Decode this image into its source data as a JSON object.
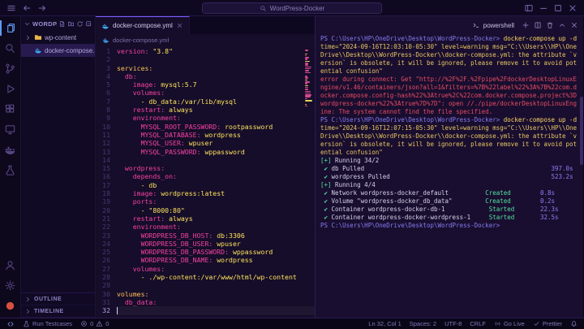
{
  "title_bar": {
    "search_value": "WordPress-Docker",
    "left_icons": [
      {
        "name": "menu",
        "icon": "menu"
      },
      {
        "name": "back",
        "icon": "arrow-left"
      },
      {
        "name": "forward",
        "icon": "arrow-right"
      }
    ],
    "right_icons": [
      {
        "name": "layout-toggle",
        "icon": "layout"
      },
      {
        "name": "minimize",
        "icon": "minimize"
      },
      {
        "name": "maximize",
        "icon": "maximize"
      },
      {
        "name": "close-window",
        "icon": "close"
      }
    ]
  },
  "activity_bar": {
    "top": [
      {
        "name": "explorer",
        "icon": "files",
        "active": true
      },
      {
        "name": "search",
        "icon": "search"
      },
      {
        "name": "source-control",
        "icon": "source-control"
      },
      {
        "name": "run-debug",
        "icon": "play"
      },
      {
        "name": "extensions",
        "icon": "extensions"
      },
      {
        "name": "remote-explorer",
        "icon": "monitor"
      },
      {
        "name": "docker",
        "icon": "docker"
      },
      {
        "name": "testing",
        "icon": "beaker"
      }
    ],
    "bottom": [
      {
        "name": "account",
        "icon": "account"
      },
      {
        "name": "settings",
        "icon": "gear"
      },
      {
        "name": "profile-badge",
        "icon": "dot",
        "color": "#d75040"
      }
    ]
  },
  "sidebar": {
    "header": "WORDP...",
    "actions": [
      "new-file",
      "new-folder",
      "refresh",
      "collapse-all"
    ],
    "items": [
      {
        "label": "wp-content",
        "type": "folder",
        "chevron": true
      },
      {
        "label": "docker-compose...",
        "type": "docker-file",
        "selected": true
      }
    ],
    "sections": [
      {
        "label": "OUTLINE"
      },
      {
        "label": "TIMELINE"
      }
    ]
  },
  "editor": {
    "tab": {
      "label": "docker-compose.yml",
      "icon": "docker-file"
    },
    "breadcrumb": {
      "label": "docker-compose.yml",
      "icon": "docker-file"
    },
    "cursor_line": 32,
    "lines": [
      {
        "n": 1,
        "tokens": [
          [
            "k",
            "version:"
          ],
          [
            "v",
            " \"3.8\""
          ]
        ]
      },
      {
        "n": 2,
        "tokens": []
      },
      {
        "n": 3,
        "tokens": [
          [
            "t",
            "services:"
          ]
        ]
      },
      {
        "n": 4,
        "tokens": [
          [
            "w",
            "  "
          ],
          [
            "k",
            "db:"
          ]
        ]
      },
      {
        "n": 5,
        "tokens": [
          [
            "w",
            "    "
          ],
          [
            "k",
            "image:"
          ],
          [
            "v",
            " mysql:5.7"
          ]
        ]
      },
      {
        "n": 6,
        "tokens": [
          [
            "w",
            "    "
          ],
          [
            "k",
            "volumes:"
          ]
        ]
      },
      {
        "n": 7,
        "tokens": [
          [
            "w",
            "      "
          ],
          [
            "v",
            "- db_data:/var/lib/mysql"
          ]
        ]
      },
      {
        "n": 8,
        "tokens": [
          [
            "w",
            "    "
          ],
          [
            "k",
            "restart:"
          ],
          [
            "v",
            " always"
          ]
        ]
      },
      {
        "n": 9,
        "tokens": [
          [
            "w",
            "    "
          ],
          [
            "k",
            "environment:"
          ]
        ]
      },
      {
        "n": 10,
        "tokens": [
          [
            "w",
            "      "
          ],
          [
            "k",
            "MYSQL_ROOT_PASSWORD:"
          ],
          [
            "v",
            " rootpassword"
          ]
        ]
      },
      {
        "n": 11,
        "tokens": [
          [
            "w",
            "      "
          ],
          [
            "k",
            "MYSQL_DATABASE:"
          ],
          [
            "v",
            " wordpress"
          ]
        ]
      },
      {
        "n": 12,
        "tokens": [
          [
            "w",
            "      "
          ],
          [
            "k",
            "MYSQL_USER:"
          ],
          [
            "v",
            " wpuser"
          ]
        ]
      },
      {
        "n": 13,
        "tokens": [
          [
            "w",
            "      "
          ],
          [
            "k",
            "MYSQL_PASSWORD:"
          ],
          [
            "v",
            " wppassword"
          ]
        ]
      },
      {
        "n": 14,
        "tokens": []
      },
      {
        "n": 15,
        "tokens": [
          [
            "w",
            "  "
          ],
          [
            "k",
            "wordpress:"
          ]
        ]
      },
      {
        "n": 16,
        "tokens": [
          [
            "w",
            "    "
          ],
          [
            "k",
            "depends_on:"
          ]
        ]
      },
      {
        "n": 17,
        "tokens": [
          [
            "w",
            "      "
          ],
          [
            "v",
            "- db"
          ]
        ]
      },
      {
        "n": 18,
        "tokens": [
          [
            "w",
            "    "
          ],
          [
            "k",
            "image:"
          ],
          [
            "v",
            " wordpress:latest"
          ]
        ]
      },
      {
        "n": 19,
        "tokens": [
          [
            "w",
            "    "
          ],
          [
            "k",
            "ports:"
          ]
        ]
      },
      {
        "n": 20,
        "tokens": [
          [
            "w",
            "      "
          ],
          [
            "v",
            "- \"8000:80\""
          ]
        ]
      },
      {
        "n": 21,
        "tokens": [
          [
            "w",
            "    "
          ],
          [
            "k",
            "restart:"
          ],
          [
            "v",
            " always"
          ]
        ]
      },
      {
        "n": 22,
        "tokens": [
          [
            "w",
            "    "
          ],
          [
            "k",
            "environment:"
          ]
        ]
      },
      {
        "n": 23,
        "tokens": [
          [
            "w",
            "      "
          ],
          [
            "k",
            "WORDPRESS_DB_HOST:"
          ],
          [
            "v",
            " db:3306"
          ]
        ]
      },
      {
        "n": 24,
        "tokens": [
          [
            "w",
            "      "
          ],
          [
            "k",
            "WORDPRESS_DB_USER:"
          ],
          [
            "v",
            " wpuser"
          ]
        ]
      },
      {
        "n": 25,
        "tokens": [
          [
            "w",
            "      "
          ],
          [
            "k",
            "WORDPRESS_DB_PASSWORD:"
          ],
          [
            "v",
            " wppassword"
          ]
        ]
      },
      {
        "n": 26,
        "tokens": [
          [
            "w",
            "      "
          ],
          [
            "k",
            "WORDPRESS_DB_NAME:"
          ],
          [
            "v",
            " wordpress"
          ]
        ]
      },
      {
        "n": 27,
        "tokens": [
          [
            "w",
            "    "
          ],
          [
            "k",
            "volumes:"
          ]
        ]
      },
      {
        "n": 28,
        "tokens": [
          [
            "w",
            "      "
          ],
          [
            "v",
            "- ./wp-content:/var/www/html/wp-content"
          ]
        ]
      },
      {
        "n": 29,
        "tokens": []
      },
      {
        "n": 30,
        "tokens": [
          [
            "t",
            "volumes:"
          ]
        ]
      },
      {
        "n": 31,
        "tokens": [
          [
            "w",
            "  "
          ],
          [
            "k",
            "db_data:"
          ]
        ]
      },
      {
        "n": 32,
        "tokens": []
      }
    ]
  },
  "terminal": {
    "tab_label": "powershell",
    "actions": [
      "add",
      "split",
      "trash",
      "chevron-up",
      "close"
    ],
    "lines": [
      {
        "seg": [
          [
            "pr",
            "PS C:\\Users\\HP\\OneDrive\\Desktop\\WordPress-Docker>"
          ],
          [
            "cm",
            " docker-compose up -d"
          ]
        ]
      },
      {
        "seg": [
          [
            "wr",
            "time=\"2024-09-16T12:03:10-05:30\" level=warning msg=\"C:\\\\Users\\\\HP\\\\OneDrive\\\\Desktop\\\\WordPress-Docker\\\\docker-compose.yml: the attribute `version` is obsolete, it will be ignored, please remove it to avoid potential confusion\""
          ]
        ]
      },
      {
        "seg": [
          [
            "er",
            "error during connect: Get \"http://%2F%2F.%2Fpipe%2FdockerDesktopLinuxEngine/v1.46/containers/json?all=1&filters=%7B%22label%22%3A%7B%22com.docker.compose.config-hash%22%3Atrue%2C%22com.docker.compose.project%3Dwordpress-docker%22%3Atrue%7D%7D\": open //./pipe/dockerDesktopLinuxEngine: The system cannot find the file specified."
          ]
        ]
      },
      {
        "seg": [
          [
            "pr",
            "PS C:\\Users\\HP\\OneDrive\\Desktop\\WordPress-Docker>"
          ],
          [
            "cm",
            " docker-compose up -d"
          ]
        ]
      },
      {
        "seg": [
          [
            "wr",
            "time=\"2024-09-16T12:07:15-05:30\" level=warning msg=\"C:\\\\Users\\\\HP\\\\OneDrive\\\\Desktop\\\\WordPress-Docker\\\\docker-compose.yml: the attribute `version` is obsolete, it will be ignored, please remove it to avoid potential confusion\""
          ]
        ]
      },
      {
        "seg": [
          [
            "ok",
            "[+]"
          ],
          [
            "tx",
            " Running 34/2"
          ]
        ]
      },
      {
        "seg": [
          [
            "ok",
            " ✔"
          ],
          [
            "tx",
            " db Pulled                                                   "
          ],
          [
            "tm",
            "397.0s"
          ]
        ]
      },
      {
        "seg": [
          [
            "ok",
            " ✔"
          ],
          [
            "tx",
            " wordpress Pulled                                            "
          ],
          [
            "tm",
            "523.2s"
          ]
        ]
      },
      {
        "seg": [
          [
            "ok",
            "[+]"
          ],
          [
            "tx",
            " Running 4/4"
          ]
        ]
      },
      {
        "seg": [
          [
            "ok",
            " ✔"
          ],
          [
            "tx",
            " Network wordpress-docker_default          "
          ],
          [
            "gr",
            "Created"
          ],
          [
            "tx",
            "        "
          ],
          [
            "tm",
            "0.8s"
          ]
        ]
      },
      {
        "seg": [
          [
            "ok",
            " ✔"
          ],
          [
            "tx",
            " Volume \"wordpress-docker_db_data\"         "
          ],
          [
            "gr",
            "Created"
          ],
          [
            "tx",
            "        "
          ],
          [
            "tm",
            "0.2s"
          ]
        ]
      },
      {
        "seg": [
          [
            "ok",
            " ✔"
          ],
          [
            "tx",
            " Container wordpress-docker-db-1            "
          ],
          [
            "gr",
            "Started"
          ],
          [
            "tx",
            "       "
          ],
          [
            "tm",
            "22.3s"
          ]
        ]
      },
      {
        "seg": [
          [
            "ok",
            " ✔"
          ],
          [
            "tx",
            " Container wordpress-docker-wordpress-1     "
          ],
          [
            "gr",
            "Started"
          ],
          [
            "tx",
            "       "
          ],
          [
            "tm",
            "32.5s"
          ]
        ]
      },
      {
        "seg": [
          [
            "pr",
            "PS C:\\Users\\HP\\OneDrive\\Desktop\\WordPress-Docker>"
          ]
        ]
      }
    ]
  },
  "status_bar": {
    "left": [
      {
        "name": "remote",
        "parts": [
          {
            "icon": "remote"
          }
        ]
      },
      {
        "name": "run-testcases",
        "parts": [
          {
            "icon": "beaker"
          },
          {
            "text": "Run Testcases"
          }
        ]
      },
      {
        "name": "problems",
        "parts": [
          {
            "icon": "error-circle"
          },
          {
            "text": "0"
          },
          {
            "icon": "warning"
          },
          {
            "text": "0"
          }
        ]
      }
    ],
    "right": [
      {
        "name": "cursor-position",
        "parts": [
          {
            "text": "Ln 32, Col 1"
          }
        ]
      },
      {
        "name": "indentation",
        "parts": [
          {
            "text": "Spaces: 2"
          }
        ]
      },
      {
        "name": "encoding",
        "parts": [
          {
            "text": "UTF-8"
          }
        ]
      },
      {
        "name": "eol",
        "parts": [
          {
            "text": "CRLF"
          }
        ]
      },
      {
        "name": "go-live",
        "parts": [
          {
            "icon": "broadcast"
          },
          {
            "text": "Go Live"
          }
        ]
      },
      {
        "name": "prettier",
        "parts": [
          {
            "icon": "check"
          },
          {
            "text": "Prettier"
          }
        ]
      },
      {
        "name": "notifications",
        "parts": [
          {
            "icon": "bell"
          }
        ]
      }
    ]
  },
  "colors": {
    "accent_pink": "#f542a1",
    "value_yellow": "#ffe25f",
    "top_key_orange": "#fdc05a",
    "prompt_purple": "#857df2",
    "success_green": "#54e0a0",
    "error_red": "#e84b63",
    "active_icon_blue": "#5d9bf7"
  }
}
